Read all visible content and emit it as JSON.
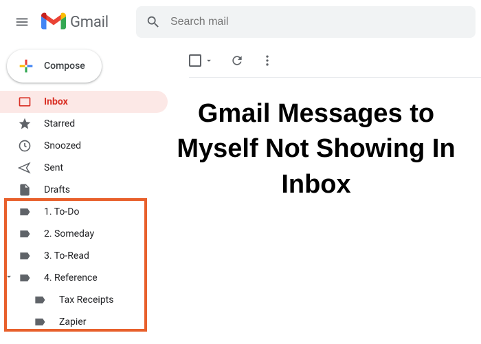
{
  "header": {
    "brand": "Gmail",
    "search_placeholder": "Search mail"
  },
  "compose": {
    "label": "Compose"
  },
  "sidebar": {
    "system": [
      {
        "label": "Inbox",
        "icon": "inbox",
        "active": true
      },
      {
        "label": "Starred",
        "icon": "star",
        "active": false
      },
      {
        "label": "Snoozed",
        "icon": "clock",
        "active": false
      },
      {
        "label": "Sent",
        "icon": "send",
        "active": false
      },
      {
        "label": "Drafts",
        "icon": "file",
        "active": false
      }
    ],
    "labels": [
      {
        "label": "1. To-Do",
        "icon": "label",
        "indent": 0,
        "expandable": false
      },
      {
        "label": "2. Someday",
        "icon": "label",
        "indent": 0,
        "expandable": false
      },
      {
        "label": "3. To-Read",
        "icon": "label",
        "indent": 0,
        "expandable": false
      },
      {
        "label": "4. Reference",
        "icon": "label",
        "indent": 0,
        "expandable": true,
        "expanded": true
      },
      {
        "label": "Tax Receipts",
        "icon": "label",
        "indent": 1,
        "expandable": false
      },
      {
        "label": "Zapier",
        "icon": "label",
        "indent": 1,
        "expandable": false
      }
    ]
  },
  "headline": "Gmail Messages to Myself Not Showing In Inbox"
}
